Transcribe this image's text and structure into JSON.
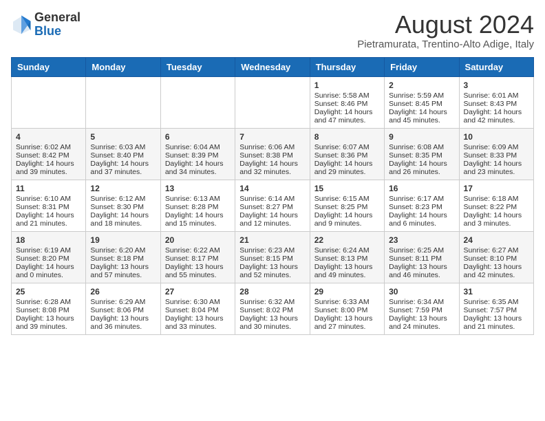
{
  "header": {
    "logo_line1": "General",
    "logo_line2": "Blue",
    "month_year": "August 2024",
    "location": "Pietramurata, Trentino-Alto Adige, Italy"
  },
  "weekdays": [
    "Sunday",
    "Monday",
    "Tuesday",
    "Wednesday",
    "Thursday",
    "Friday",
    "Saturday"
  ],
  "weeks": [
    [
      {
        "day": "",
        "content": ""
      },
      {
        "day": "",
        "content": ""
      },
      {
        "day": "",
        "content": ""
      },
      {
        "day": "",
        "content": ""
      },
      {
        "day": "1",
        "content": "Sunrise: 5:58 AM\nSunset: 8:46 PM\nDaylight: 14 hours and 47 minutes."
      },
      {
        "day": "2",
        "content": "Sunrise: 5:59 AM\nSunset: 8:45 PM\nDaylight: 14 hours and 45 minutes."
      },
      {
        "day": "3",
        "content": "Sunrise: 6:01 AM\nSunset: 8:43 PM\nDaylight: 14 hours and 42 minutes."
      }
    ],
    [
      {
        "day": "4",
        "content": "Sunrise: 6:02 AM\nSunset: 8:42 PM\nDaylight: 14 hours and 39 minutes."
      },
      {
        "day": "5",
        "content": "Sunrise: 6:03 AM\nSunset: 8:40 PM\nDaylight: 14 hours and 37 minutes."
      },
      {
        "day": "6",
        "content": "Sunrise: 6:04 AM\nSunset: 8:39 PM\nDaylight: 14 hours and 34 minutes."
      },
      {
        "day": "7",
        "content": "Sunrise: 6:06 AM\nSunset: 8:38 PM\nDaylight: 14 hours and 32 minutes."
      },
      {
        "day": "8",
        "content": "Sunrise: 6:07 AM\nSunset: 8:36 PM\nDaylight: 14 hours and 29 minutes."
      },
      {
        "day": "9",
        "content": "Sunrise: 6:08 AM\nSunset: 8:35 PM\nDaylight: 14 hours and 26 minutes."
      },
      {
        "day": "10",
        "content": "Sunrise: 6:09 AM\nSunset: 8:33 PM\nDaylight: 14 hours and 23 minutes."
      }
    ],
    [
      {
        "day": "11",
        "content": "Sunrise: 6:10 AM\nSunset: 8:31 PM\nDaylight: 14 hours and 21 minutes."
      },
      {
        "day": "12",
        "content": "Sunrise: 6:12 AM\nSunset: 8:30 PM\nDaylight: 14 hours and 18 minutes."
      },
      {
        "day": "13",
        "content": "Sunrise: 6:13 AM\nSunset: 8:28 PM\nDaylight: 14 hours and 15 minutes."
      },
      {
        "day": "14",
        "content": "Sunrise: 6:14 AM\nSunset: 8:27 PM\nDaylight: 14 hours and 12 minutes."
      },
      {
        "day": "15",
        "content": "Sunrise: 6:15 AM\nSunset: 8:25 PM\nDaylight: 14 hours and 9 minutes."
      },
      {
        "day": "16",
        "content": "Sunrise: 6:17 AM\nSunset: 8:23 PM\nDaylight: 14 hours and 6 minutes."
      },
      {
        "day": "17",
        "content": "Sunrise: 6:18 AM\nSunset: 8:22 PM\nDaylight: 14 hours and 3 minutes."
      }
    ],
    [
      {
        "day": "18",
        "content": "Sunrise: 6:19 AM\nSunset: 8:20 PM\nDaylight: 14 hours and 0 minutes."
      },
      {
        "day": "19",
        "content": "Sunrise: 6:20 AM\nSunset: 8:18 PM\nDaylight: 13 hours and 57 minutes."
      },
      {
        "day": "20",
        "content": "Sunrise: 6:22 AM\nSunset: 8:17 PM\nDaylight: 13 hours and 55 minutes."
      },
      {
        "day": "21",
        "content": "Sunrise: 6:23 AM\nSunset: 8:15 PM\nDaylight: 13 hours and 52 minutes."
      },
      {
        "day": "22",
        "content": "Sunrise: 6:24 AM\nSunset: 8:13 PM\nDaylight: 13 hours and 49 minutes."
      },
      {
        "day": "23",
        "content": "Sunrise: 6:25 AM\nSunset: 8:11 PM\nDaylight: 13 hours and 46 minutes."
      },
      {
        "day": "24",
        "content": "Sunrise: 6:27 AM\nSunset: 8:10 PM\nDaylight: 13 hours and 42 minutes."
      }
    ],
    [
      {
        "day": "25",
        "content": "Sunrise: 6:28 AM\nSunset: 8:08 PM\nDaylight: 13 hours and 39 minutes."
      },
      {
        "day": "26",
        "content": "Sunrise: 6:29 AM\nSunset: 8:06 PM\nDaylight: 13 hours and 36 minutes."
      },
      {
        "day": "27",
        "content": "Sunrise: 6:30 AM\nSunset: 8:04 PM\nDaylight: 13 hours and 33 minutes."
      },
      {
        "day": "28",
        "content": "Sunrise: 6:32 AM\nSunset: 8:02 PM\nDaylight: 13 hours and 30 minutes."
      },
      {
        "day": "29",
        "content": "Sunrise: 6:33 AM\nSunset: 8:00 PM\nDaylight: 13 hours and 27 minutes."
      },
      {
        "day": "30",
        "content": "Sunrise: 6:34 AM\nSunset: 7:59 PM\nDaylight: 13 hours and 24 minutes."
      },
      {
        "day": "31",
        "content": "Sunrise: 6:35 AM\nSunset: 7:57 PM\nDaylight: 13 hours and 21 minutes."
      }
    ]
  ]
}
